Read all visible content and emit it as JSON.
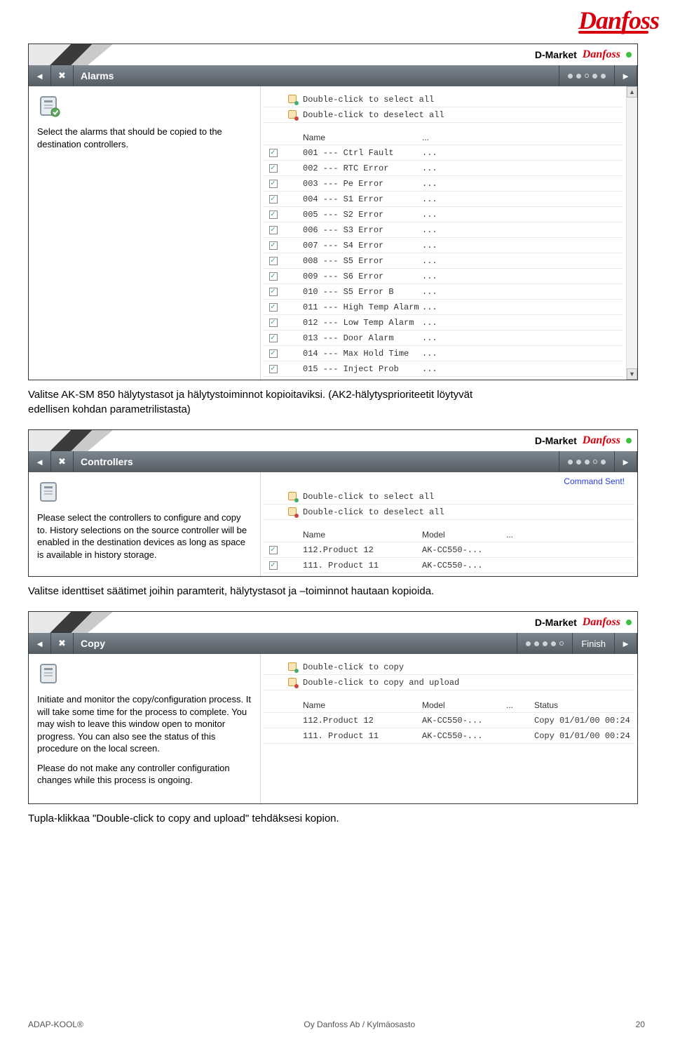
{
  "brand": "Danfoss",
  "header": {
    "market": "D-Market"
  },
  "common": {
    "selectAll": "Double-click to select all",
    "deselectAll": "Double-click to deselect all",
    "colName": "Name",
    "colModel": "Model",
    "colStatus": "Status",
    "ellipsis": "..."
  },
  "win1": {
    "title": "Alarms",
    "instruction": "Select the alarms that should be copied to the destination controllers.",
    "rows": [
      {
        "checked": true,
        "name": "001 --- Ctrl Fault"
      },
      {
        "checked": true,
        "name": "002 --- RTC Error"
      },
      {
        "checked": true,
        "name": "003 --- Pe Error"
      },
      {
        "checked": true,
        "name": "004 --- S1 Error"
      },
      {
        "checked": true,
        "name": "005 --- S2 Error"
      },
      {
        "checked": true,
        "name": "006 --- S3 Error"
      },
      {
        "checked": true,
        "name": "007 --- S4 Error"
      },
      {
        "checked": true,
        "name": "008 --- S5 Error"
      },
      {
        "checked": true,
        "name": "009 --- S6 Error"
      },
      {
        "checked": true,
        "name": "010 --- S5 Error B"
      },
      {
        "checked": true,
        "name": "011 --- High Temp Alarm"
      },
      {
        "checked": true,
        "name": "012 --- Low Temp Alarm"
      },
      {
        "checked": true,
        "name": "013 --- Door Alarm"
      },
      {
        "checked": true,
        "name": "014 --- Max Hold Time"
      },
      {
        "checked": true,
        "name": "015 --- Inject Prob"
      }
    ]
  },
  "win2": {
    "title": "Controllers",
    "instruction": "Please select the controllers to configure and copy to. History selections on the source controller will be enabled in the destination devices as long as space is available in history storage.",
    "commandSent": "Command Sent!",
    "rows": [
      {
        "checked": true,
        "name": "112.Product 12",
        "model": "AK-CC550-..."
      },
      {
        "checked": true,
        "name": "111. Product 11",
        "model": "AK-CC550-..."
      }
    ]
  },
  "win3": {
    "title": "Copy",
    "finish": "Finish",
    "instruction1": "Initiate and monitor the copy/configuration process. It will take some time for the process to complete. You may wish to leave this window open to monitor progress. You can also see the status of this procedure on the local screen.",
    "instruction2": "Please do not make any controller configuration changes while this process is ongoing.",
    "dcCopy": "Double-click to copy",
    "dcCopyUpload": "Double-click to copy and upload",
    "rows": [
      {
        "name": "112.Product 12",
        "model": "AK-CC550-...",
        "status": "Copy 01/01/00 00:24"
      },
      {
        "name": "111. Product 11",
        "model": "AK-CC550-...",
        "status": "Copy 01/01/00 00:24"
      }
    ]
  },
  "captions": {
    "c1a": "Valitse AK-SM 850 hälytystasot ja hälytystoiminnot kopioitaviksi. (AK2-hälytysprioriteetit löytyvät",
    "c1b": "edellisen kohdan parametrilistasta)",
    "c2": "Valitse identtiset säätimet joihin paramterit, hälytystasot ja –toiminnot hautaan kopioida.",
    "c3": "Tupla-klikkaa \"Double-click to copy and upload\" tehdäksesi kopion."
  },
  "footer": {
    "left": "ADAP-KOOL®",
    "center": "Oy Danfoss Ab / Kylmäosasto",
    "page": "20"
  }
}
